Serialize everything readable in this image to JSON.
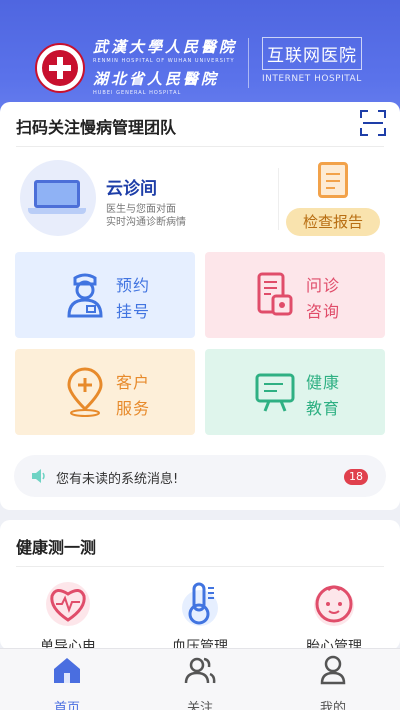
{
  "header": {
    "hosp_cn_line1": "武漢大學人民醫院",
    "hosp_en_line1": "RENMIN HOSPITAL OF WUHAN UNIVERSITY",
    "hosp_cn_line2": "湖北省人民醫院",
    "hosp_en_line2": "HUBEI GENERAL HOSPITAL",
    "internet_cn": "互联网医院",
    "internet_en": "INTERNET HOSPITAL",
    "gradient_top": "#4f66e0"
  },
  "team": {
    "title": "扫码关注慢病管理团队"
  },
  "cloud": {
    "title": "云诊间",
    "sub1": "医生与您面对面",
    "sub2": "实时沟通诊断病情",
    "report_label": "检查报告"
  },
  "tiles": [
    {
      "line1": "预约",
      "line2": "挂号",
      "icon": "nurse-icon",
      "color": "#4174e0"
    },
    {
      "line1": "问诊",
      "line2": "咨询",
      "icon": "consult-icon",
      "color": "#e04d6a"
    },
    {
      "line1": "客户",
      "line2": "服务",
      "icon": "location-plus-icon",
      "color": "#e78a2b"
    },
    {
      "line1": "健康",
      "line2": "教育",
      "icon": "monitor-icon",
      "color": "#2fb083"
    }
  ],
  "message": {
    "text": "您有未读的系统消息!",
    "count": "18"
  },
  "health": {
    "title": "健康测一测",
    "items": [
      {
        "label": "单导心电",
        "icon": "heart-icon"
      },
      {
        "label": "血压管理",
        "icon": "thermometer-icon"
      },
      {
        "label": "胎心管理",
        "icon": "baby-icon"
      }
    ]
  },
  "tabbar": {
    "tabs": [
      {
        "label": "首页",
        "icon": "home-icon",
        "active": true
      },
      {
        "label": "关注",
        "icon": "users-icon",
        "active": false
      },
      {
        "label": "我的",
        "icon": "person-icon",
        "active": false
      }
    ]
  }
}
